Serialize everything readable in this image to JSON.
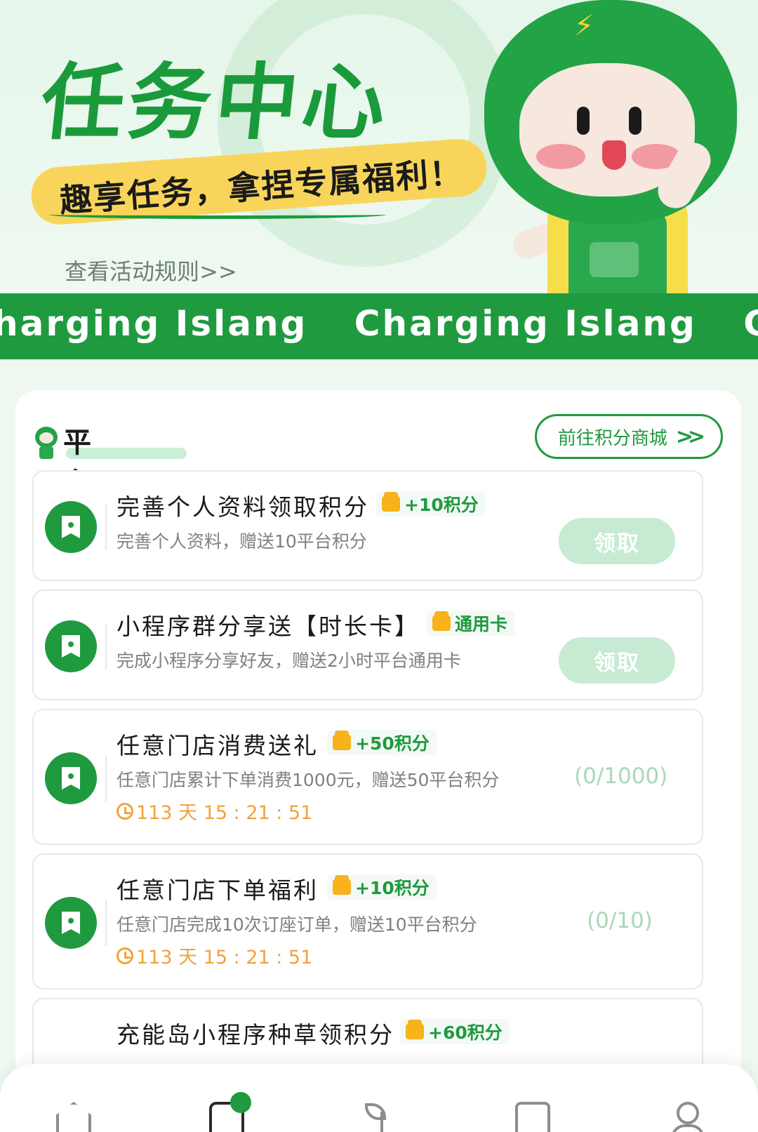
{
  "hero": {
    "title": "任务中心",
    "slogan": "趣享任务，拿捏专属福利！",
    "rules_link": "查看活动规则>>"
  },
  "banner": {
    "text_1": "harging Islang",
    "text_2": "Charging Islang",
    "text_3": "Charging I"
  },
  "section": {
    "title": "平台任务",
    "mall_button": "前往积分商城",
    "mall_chevron": ">>"
  },
  "tasks": [
    {
      "title": "完善个人资料领取积分",
      "reward": "+10积分",
      "desc": "完善个人资料，赠送10平台积分",
      "action": "领取"
    },
    {
      "title": "小程序群分享送【时长卡】",
      "reward": "通用卡",
      "desc": "完成小程序分享好友，赠送2小时平台通用卡",
      "action": "领取"
    },
    {
      "title": "任意门店消费送礼",
      "reward": "+50积分",
      "desc": "任意门店累计下单消费1000元，赠送50平台积分",
      "progress": "(0/1000)",
      "timer": "113 天 15 : 21 : 51"
    },
    {
      "title": "任意门店下单福利",
      "reward": "+10积分",
      "desc": "任意门店完成10次订座订单，赠送10平台积分",
      "progress": "(0/10)",
      "timer": "113 天 15 : 21 : 51"
    },
    {
      "title": "充能岛小程序种草领积分",
      "reward": "+60积分"
    }
  ],
  "colors": {
    "brand_green": "#1f9a3f",
    "slogan_yellow": "#f8d55a",
    "timer_orange": "#f2a23a",
    "reward_gift": "#f7b21c"
  },
  "icons": {
    "bolt": "⚡",
    "task": "bookmark-icon",
    "clock": "clock-icon",
    "gift": "gift-icon",
    "tabs": [
      "home-icon",
      "task-icon",
      "plant-icon",
      "checklist-icon",
      "user-icon"
    ]
  }
}
